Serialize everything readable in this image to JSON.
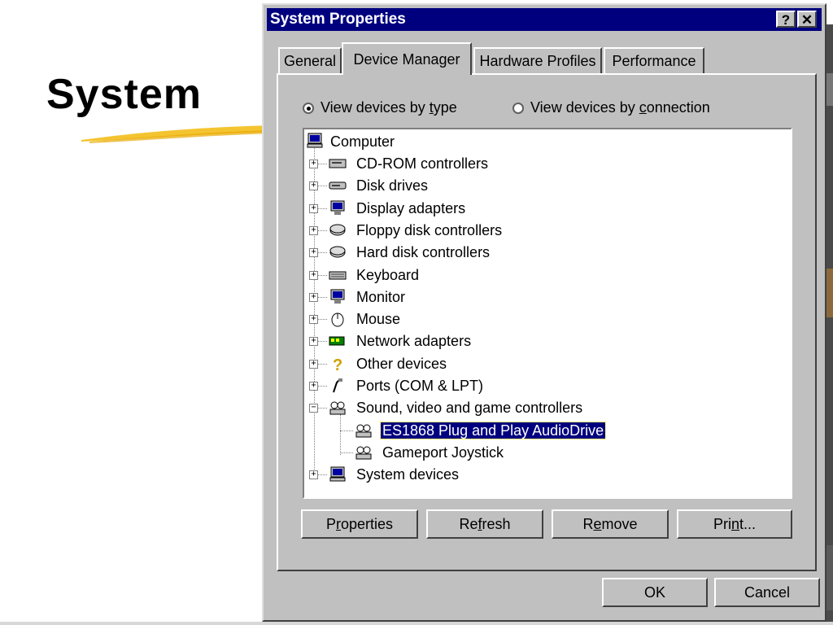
{
  "slide": {
    "title": "System"
  },
  "dialog": {
    "title": "System Properties",
    "help_label": "?",
    "close_label": "✕",
    "tabs": [
      {
        "label": "General"
      },
      {
        "label": "Device Manager"
      },
      {
        "label": "Hardware Profiles"
      },
      {
        "label": "Performance"
      }
    ],
    "active_tab": "Device Manager",
    "view_by_type": {
      "pre": "View devices by ",
      "key": "t",
      "post": "ype",
      "selected": true
    },
    "view_by_connection": {
      "pre": "View devices by ",
      "key": "c",
      "post": "onnection",
      "selected": false
    },
    "tree": {
      "root": {
        "label": "Computer",
        "icon": "computer-icon"
      },
      "items": [
        {
          "label": "CD-ROM controllers",
          "icon": "cdrom-icon",
          "expanded": false
        },
        {
          "label": "Disk drives",
          "icon": "disk-drive-icon",
          "expanded": false
        },
        {
          "label": "Display adapters",
          "icon": "display-adapter-icon",
          "expanded": false
        },
        {
          "label": "Floppy disk controllers",
          "icon": "floppy-controller-icon",
          "expanded": false
        },
        {
          "label": "Hard disk controllers",
          "icon": "hard-disk-controller-icon",
          "expanded": false
        },
        {
          "label": "Keyboard",
          "icon": "keyboard-icon",
          "expanded": false
        },
        {
          "label": "Monitor",
          "icon": "monitor-icon",
          "expanded": false
        },
        {
          "label": "Mouse",
          "icon": "mouse-icon",
          "expanded": false
        },
        {
          "label": "Network adapters",
          "icon": "network-adapter-icon",
          "expanded": false
        },
        {
          "label": "Other devices",
          "icon": "question-icon",
          "expanded": false
        },
        {
          "label": "Ports (COM & LPT)",
          "icon": "port-icon",
          "expanded": false
        },
        {
          "label": "Sound, video and game controllers",
          "icon": "sound-icon",
          "expanded": true,
          "children": [
            {
              "label": "ES1868 Plug and Play AudioDrive",
              "icon": "sound-icon",
              "selected": true
            },
            {
              "label": "Gameport Joystick",
              "icon": "sound-icon",
              "selected": false
            }
          ]
        },
        {
          "label": "System devices",
          "icon": "system-device-icon",
          "expanded": false
        }
      ]
    },
    "buttons": {
      "properties": {
        "pre": "P",
        "key": "r",
        "post": "operties"
      },
      "refresh": {
        "pre": "Re",
        "key": "f",
        "post": "resh"
      },
      "remove": {
        "pre": "R",
        "key": "e",
        "post": "move"
      },
      "print": {
        "pre": "Pri",
        "key": "n",
        "post": "t..."
      },
      "ok": "OK",
      "cancel": "Cancel"
    },
    "colors": {
      "titlebar": "#00007f",
      "face": "#c0c0c0",
      "selection": "#00007f"
    }
  }
}
